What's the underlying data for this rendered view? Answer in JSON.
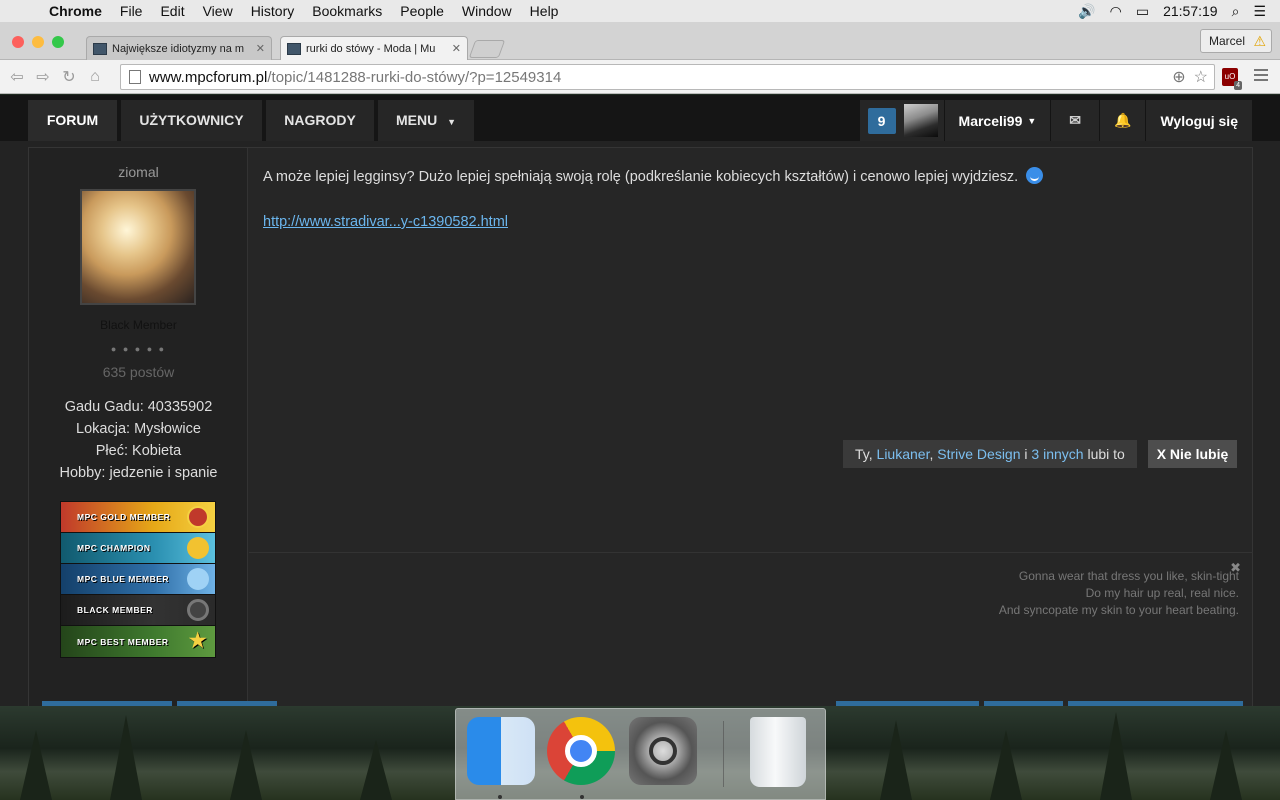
{
  "menubar": {
    "apple": "",
    "items": [
      "Chrome",
      "File",
      "Edit",
      "View",
      "History",
      "Bookmarks",
      "People",
      "Window",
      "Help"
    ],
    "clock": "21:57:19"
  },
  "browser": {
    "tabs": [
      {
        "label": "Największe idiotyzmy na m"
      },
      {
        "label": "rurki do stówy - Moda | Mu"
      }
    ],
    "profile": "Marcel",
    "url_host": "www.mpcforum.pl",
    "url_path": "/topic/1481288-rurki-do-stówy/?p=12549314",
    "extension_count": "4"
  },
  "site": {
    "nav": {
      "forum": "FORUM",
      "users": "UŻYTKOWNICY",
      "awards": "NAGRODY",
      "menu": "MENU"
    },
    "notif_count": "9",
    "username": "Marceli99",
    "logout": "Wyloguj się"
  },
  "post": {
    "author": "ziomal",
    "rank": "Black Member",
    "pips": "● ● ● ● ●",
    "post_count": "635 postów",
    "fields": {
      "gg": "Gadu Gadu: 40335902",
      "location": "Lokacja: Mysłowice",
      "gender": "Płeć: Kobieta",
      "hobby": "Hobby: jedzenie i spanie"
    },
    "ribbons": [
      {
        "label": "MPC GOLD MEMBER",
        "color": "#d9a418"
      },
      {
        "label": "MPC CHAMPION",
        "color": "#2a8fb0"
      },
      {
        "label": "MPC BLUE MEMBER",
        "color": "#2f6fa8"
      },
      {
        "label": "BLACK MEMBER",
        "color": "#2a2a2a"
      },
      {
        "label": "MPC BEST MEMBER",
        "color": "#3f7a2e"
      }
    ],
    "body": "A może lepiej legginsy? Dużo lepiej spełniają swoją rolę (podkreślanie kobiecych kształtów) i cenowo lepiej wyjdziesz.",
    "link": "http://www.stradivar...y-c1390582.html",
    "likes": {
      "prefix": "Ty, ",
      "user1": "Liukaner",
      "sep": ", ",
      "user2": "Strive Design",
      "mid": " i ",
      "others": "3 innych",
      "suffix": " lubi to"
    },
    "unlike": "X Nie lubię",
    "signature": [
      "Gonna wear that dress you like, skin-tight",
      "Do my hair up real, real nice.",
      "And syncopate my skin to your heart beating."
    ]
  },
  "colors": {
    "accent": "#2f6c9c",
    "link": "#6bb6ee"
  }
}
